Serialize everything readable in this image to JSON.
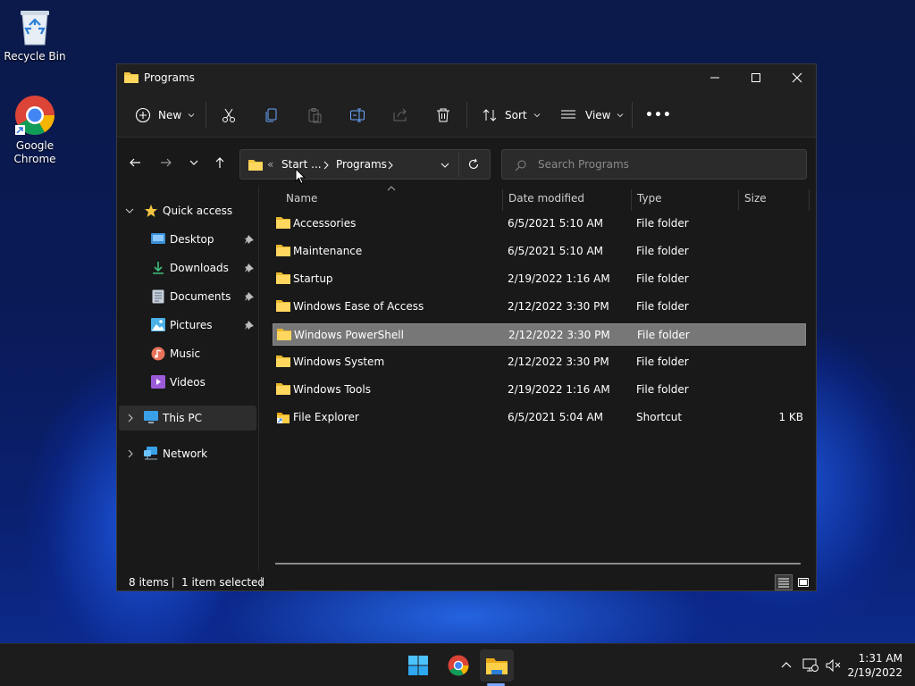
{
  "desktop": {
    "icons": [
      {
        "label": "Recycle Bin",
        "icon": "recycle-bin-icon"
      },
      {
        "label": "Google Chrome",
        "icon": "chrome-icon"
      }
    ]
  },
  "window": {
    "title": "Programs",
    "controls": {
      "minimize": "minimize-icon",
      "maximize": "maximize-icon",
      "close": "close-icon"
    }
  },
  "toolbar": {
    "new_label": "New",
    "sort_label": "Sort",
    "view_label": "View",
    "icons": [
      "cut-icon",
      "copy-icon",
      "paste-icon",
      "rename-icon",
      "share-icon",
      "delete-icon"
    ],
    "more_label": "•••"
  },
  "address": {
    "overflow": "«",
    "crumbs": [
      "Start ...",
      "Programs"
    ],
    "search_placeholder": "Search Programs"
  },
  "sidebar": {
    "quick_access": "Quick access",
    "items": [
      {
        "label": "Desktop",
        "pinned": true
      },
      {
        "label": "Downloads",
        "pinned": true
      },
      {
        "label": "Documents",
        "pinned": true
      },
      {
        "label": "Pictures",
        "pinned": true
      },
      {
        "label": "Music",
        "pinned": false
      },
      {
        "label": "Videos",
        "pinned": false
      }
    ],
    "this_pc": "This PC",
    "network": "Network"
  },
  "columns": {
    "name": "Name",
    "date": "Date modified",
    "type": "Type",
    "size": "Size"
  },
  "files": [
    {
      "name": "Accessories",
      "date": "6/5/2021 5:10 AM",
      "type": "File folder",
      "size": "",
      "kind": "folder"
    },
    {
      "name": "Maintenance",
      "date": "6/5/2021 5:10 AM",
      "type": "File folder",
      "size": "",
      "kind": "folder"
    },
    {
      "name": "Startup",
      "date": "2/19/2022 1:16 AM",
      "type": "File folder",
      "size": "",
      "kind": "folder"
    },
    {
      "name": "Windows Ease of Access",
      "date": "2/12/2022 3:30 PM",
      "type": "File folder",
      "size": "",
      "kind": "folder"
    },
    {
      "name": "Windows PowerShell",
      "date": "2/12/2022 3:30 PM",
      "type": "File folder",
      "size": "",
      "kind": "folder",
      "selected": true
    },
    {
      "name": "Windows System",
      "date": "2/12/2022 3:30 PM",
      "type": "File folder",
      "size": "",
      "kind": "folder"
    },
    {
      "name": "Windows Tools",
      "date": "2/19/2022 1:16 AM",
      "type": "File folder",
      "size": "",
      "kind": "folder"
    },
    {
      "name": "File Explorer",
      "date": "6/5/2021 5:04 AM",
      "type": "Shortcut",
      "size": "1 KB",
      "kind": "shortcut"
    }
  ],
  "status": {
    "count": "8 items",
    "selection": "1 item selected"
  },
  "taskbar": {
    "apps": [
      "start-icon",
      "chrome-icon",
      "file-explorer-icon"
    ],
    "time": "1:31 AM",
    "date": "2/19/2022"
  },
  "colors": {
    "accent": "#7aa7ff",
    "folder": "#f4c542",
    "selected_row": "#777777",
    "window_bg": "#191919"
  }
}
